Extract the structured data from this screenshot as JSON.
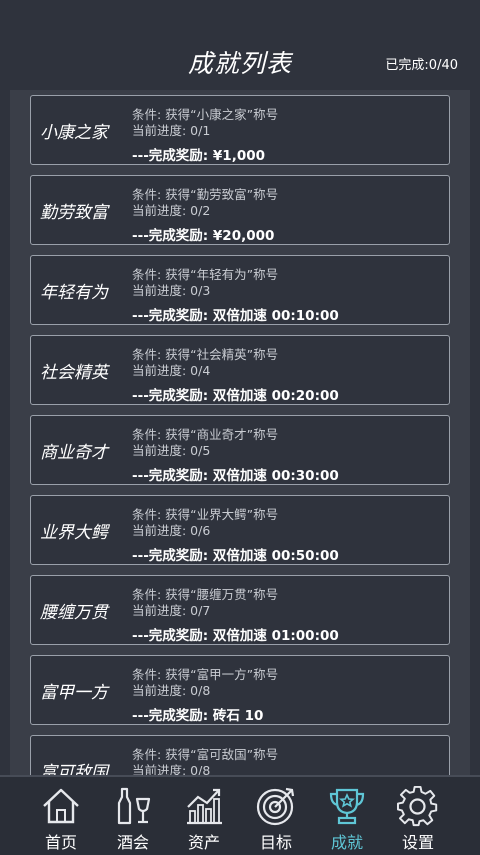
{
  "header": {
    "title": "成就列表",
    "progress": "已完成:0/40"
  },
  "achievements": [
    {
      "name": "小康之家",
      "condition": "条件: 获得“小康之家”称号",
      "progress": "当前进度: 0/1",
      "reward": "---完成奖励: ¥1,000"
    },
    {
      "name": "勤劳致富",
      "condition": "条件: 获得“勤劳致富”称号",
      "progress": "当前进度: 0/2",
      "reward": "---完成奖励: ¥20,000"
    },
    {
      "name": "年轻有为",
      "condition": "条件: 获得“年轻有为”称号",
      "progress": "当前进度: 0/3",
      "reward": "---完成奖励: 双倍加速 00:10:00"
    },
    {
      "name": "社会精英",
      "condition": "条件: 获得“社会精英”称号",
      "progress": "当前进度: 0/4",
      "reward": "---完成奖励: 双倍加速 00:20:00"
    },
    {
      "name": "商业奇才",
      "condition": "条件: 获得“商业奇才”称号",
      "progress": "当前进度: 0/5",
      "reward": "---完成奖励: 双倍加速 00:30:00"
    },
    {
      "name": "业界大鳄",
      "condition": "条件: 获得“业界大鳄”称号",
      "progress": "当前进度: 0/6",
      "reward": "---完成奖励: 双倍加速 00:50:00"
    },
    {
      "name": "腰缠万贯",
      "condition": "条件: 获得“腰缠万贯”称号",
      "progress": "当前进度: 0/7",
      "reward": "---完成奖励: 双倍加速 01:00:00"
    },
    {
      "name": "富甲一方",
      "condition": "条件: 获得“富甲一方”称号",
      "progress": "当前进度: 0/8",
      "reward": "---完成奖励: 砖石 10"
    },
    {
      "name": "富可敌国",
      "condition": "条件: 获得“富可敌国”称号",
      "progress": "当前进度: 0/8",
      "reward": ""
    }
  ],
  "tabs": [
    {
      "label": "首页",
      "icon": "home-icon"
    },
    {
      "label": "酒会",
      "icon": "wine-bottle-icon"
    },
    {
      "label": "资产",
      "icon": "chart-icon"
    },
    {
      "label": "目标",
      "icon": "target-icon"
    },
    {
      "label": "成就",
      "icon": "trophy-icon",
      "active": true
    },
    {
      "label": "设置",
      "icon": "gear-icon"
    }
  ],
  "colors": {
    "background": "#2f333d",
    "active_tab": "#5fc6d6",
    "card_border": "#9aa0aa"
  }
}
